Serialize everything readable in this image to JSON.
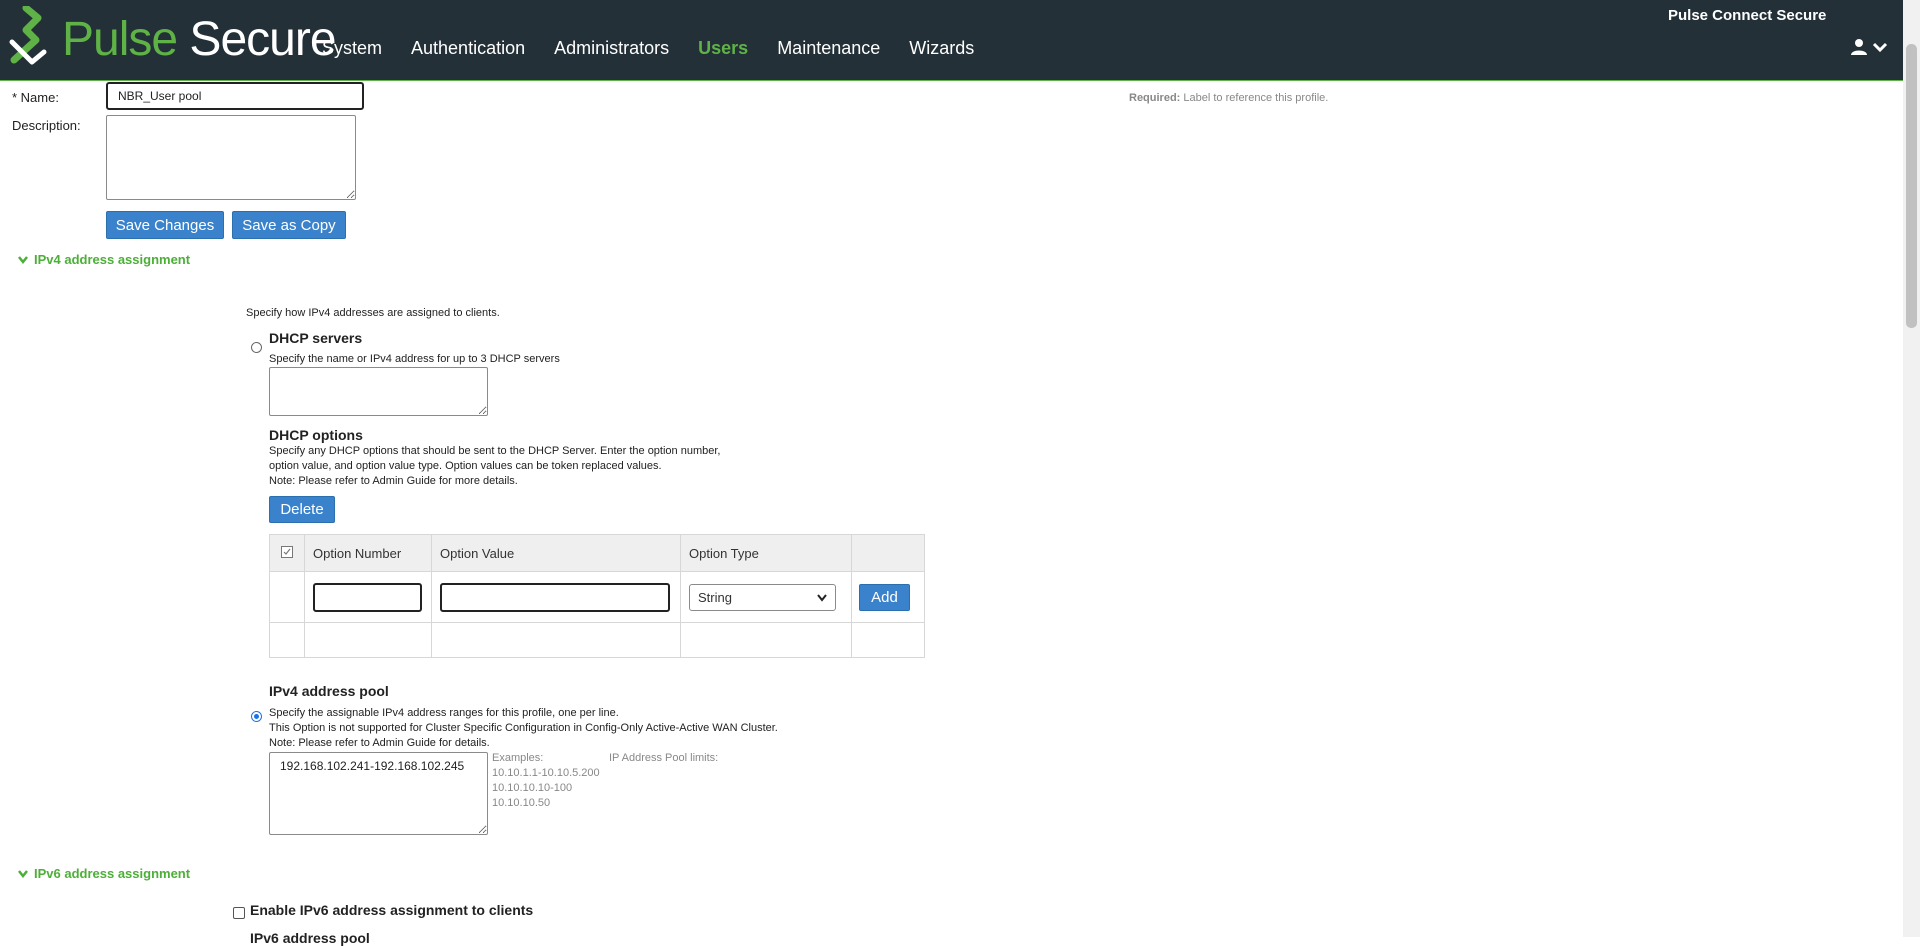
{
  "header": {
    "brand_part1": "Pulse",
    "brand_part2": "Secure",
    "product": "Pulse Connect Secure",
    "nav": [
      {
        "label": "System",
        "active": false
      },
      {
        "label": "Authentication",
        "active": false
      },
      {
        "label": "Administrators",
        "active": false
      },
      {
        "label": "Users",
        "active": true
      },
      {
        "label": "Maintenance",
        "active": false
      },
      {
        "label": "Wizards",
        "active": false
      }
    ],
    "user_icon": "user-icon",
    "accent_color": "#5fb346",
    "bar_color": "#233038"
  },
  "form": {
    "name_label": "* Name:",
    "name_value": "NBR_User pool",
    "name_hint_bold": "Required:",
    "name_hint": "Label to reference this profile.",
    "description_label": "Description:",
    "description_value": "",
    "save_changes": "Save Changes",
    "save_as_copy": "Save as Copy"
  },
  "ipv4": {
    "section_title": "IPv4 address assignment",
    "intro": "Specify how IPv4 addresses are assigned to clients.",
    "dhcp_servers_title": "DHCP servers",
    "dhcp_servers_desc": "Specify the name or IPv4 address for up to 3 DHCP servers",
    "dhcp_servers_value": "",
    "dhcp_options_title": "DHCP options",
    "dhcp_options_desc1": "Specify any DHCP options that should be sent to the DHCP Server. Enter the option number,",
    "dhcp_options_desc2": "option value, and option value type. Option values can be token replaced values.",
    "dhcp_options_note": "Note: Please refer to Admin Guide for more details.",
    "delete_button": "Delete",
    "table": {
      "columns": [
        "Option Number",
        "Option Value",
        "Option Type"
      ],
      "option_type_selected": "String",
      "add_button": "Add"
    },
    "pool_title": "IPv4 address pool",
    "pool_desc1": "Specify the assignable IPv4 address ranges for this profile, one per line.",
    "pool_desc2": "This Option is not supported for Cluster Specific Configuration in Config-Only Active-Active WAN Cluster.",
    "pool_note": "Note: Please refer to Admin Guide for details.",
    "pool_value": "192.168.102.241-192.168.102.245",
    "examples_label": "Examples:",
    "examples": [
      "10.10.1.1-10.10.5.200",
      "10.10.10.10-100",
      "10.10.10.50"
    ],
    "pool_limits_label": "IP Address Pool limits:",
    "dhcp_selected": false,
    "pool_selected": true
  },
  "ipv6": {
    "section_title": "IPv6 address assignment",
    "enable_label": "Enable IPv6 address assignment to clients",
    "enabled": false,
    "partial_heading": "IPv6 address pool"
  }
}
